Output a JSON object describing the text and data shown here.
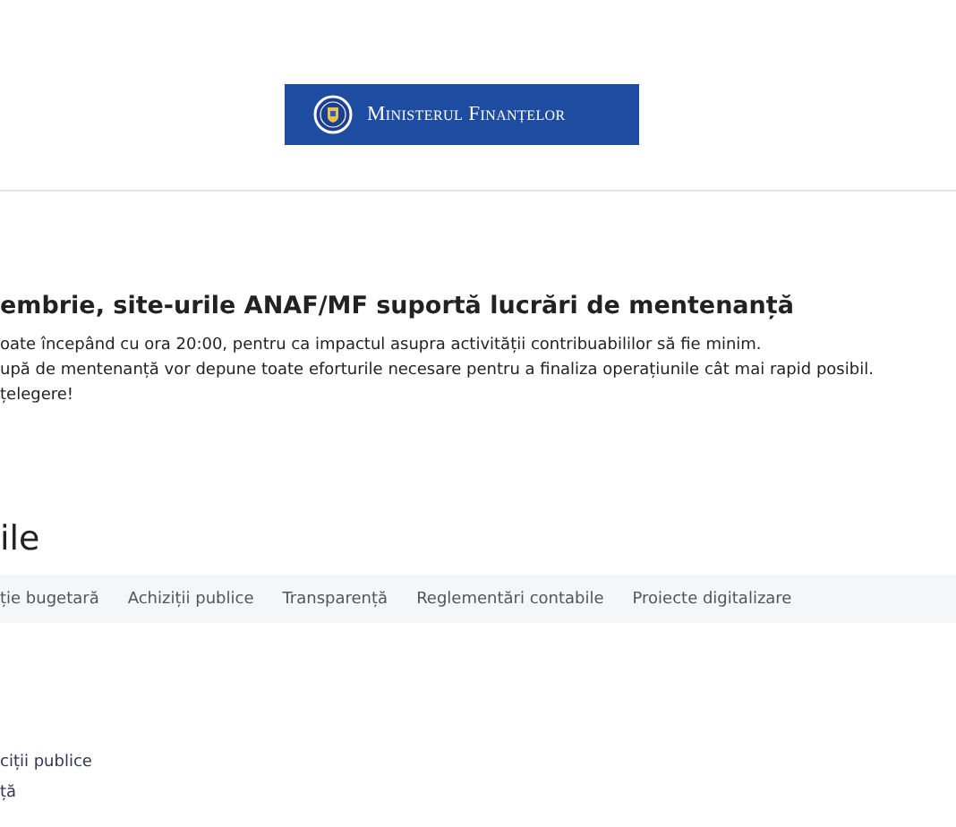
{
  "logo": {
    "text": "Ministerul Finanțelor"
  },
  "notice": {
    "title": "embrie, site-urile ANAF/MF suportă lucrări de mentenanță",
    "lines": [
      "oate începând cu ora 20:00, pentru ca impactul asupra activității contribuabililor să fie minim.",
      "upă de mentenanță vor depune toate eforturile necesare pentru a finaliza operațiunile cât mai rapid posibil.",
      "țelegere!"
    ]
  },
  "section": {
    "title": "ile"
  },
  "nav": [
    "ție bugetară",
    "Achiziții publice",
    "Transparență",
    "Reglementări contabile",
    "Proiecte digitalizare"
  ],
  "links": [
    "ciții publice",
    "ță"
  ]
}
